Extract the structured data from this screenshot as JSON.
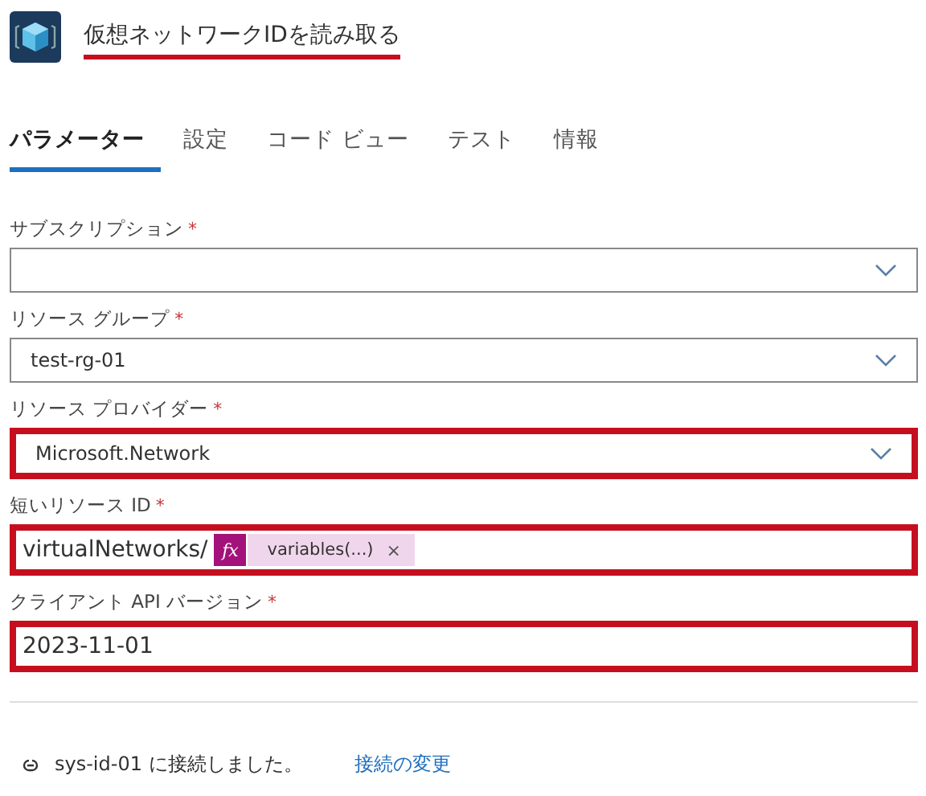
{
  "header": {
    "title": "仮想ネットワークIDを読み取る",
    "title_highlighted": true
  },
  "tabs": [
    {
      "label": "パラメーター",
      "selected": true
    },
    {
      "label": "設定",
      "selected": false
    },
    {
      "label": "コード ビュー",
      "selected": false
    },
    {
      "label": "テスト",
      "selected": false
    },
    {
      "label": "情報",
      "selected": false
    }
  ],
  "fields": [
    {
      "kind": "dropdown",
      "label": "サブスクリプション",
      "required_mark": "*",
      "highlighted": false
    },
    {
      "kind": "dropdown",
      "label": "リソース グループ",
      "required_mark": "*",
      "value": "test-rg-01",
      "highlighted": false
    },
    {
      "kind": "dropdown",
      "label": "リソース プロバイダー",
      "required_mark": "*",
      "value": "Microsoft.Network",
      "highlighted": true
    },
    {
      "kind": "expression",
      "label": "短いリソース ID",
      "required_mark": "*",
      "value": "virtualNetworks/",
      "token": {
        "icon": "fx",
        "text": "variables(...)",
        "remove": "×"
      },
      "highlighted": true
    },
    {
      "kind": "text",
      "label": "クライアント API バージョン",
      "required_mark": "*",
      "value": "2023-11-01",
      "highlighted": true
    }
  ],
  "footer": {
    "connection": "sys-id-01 に接続しました。",
    "link": "接続の変更"
  }
}
